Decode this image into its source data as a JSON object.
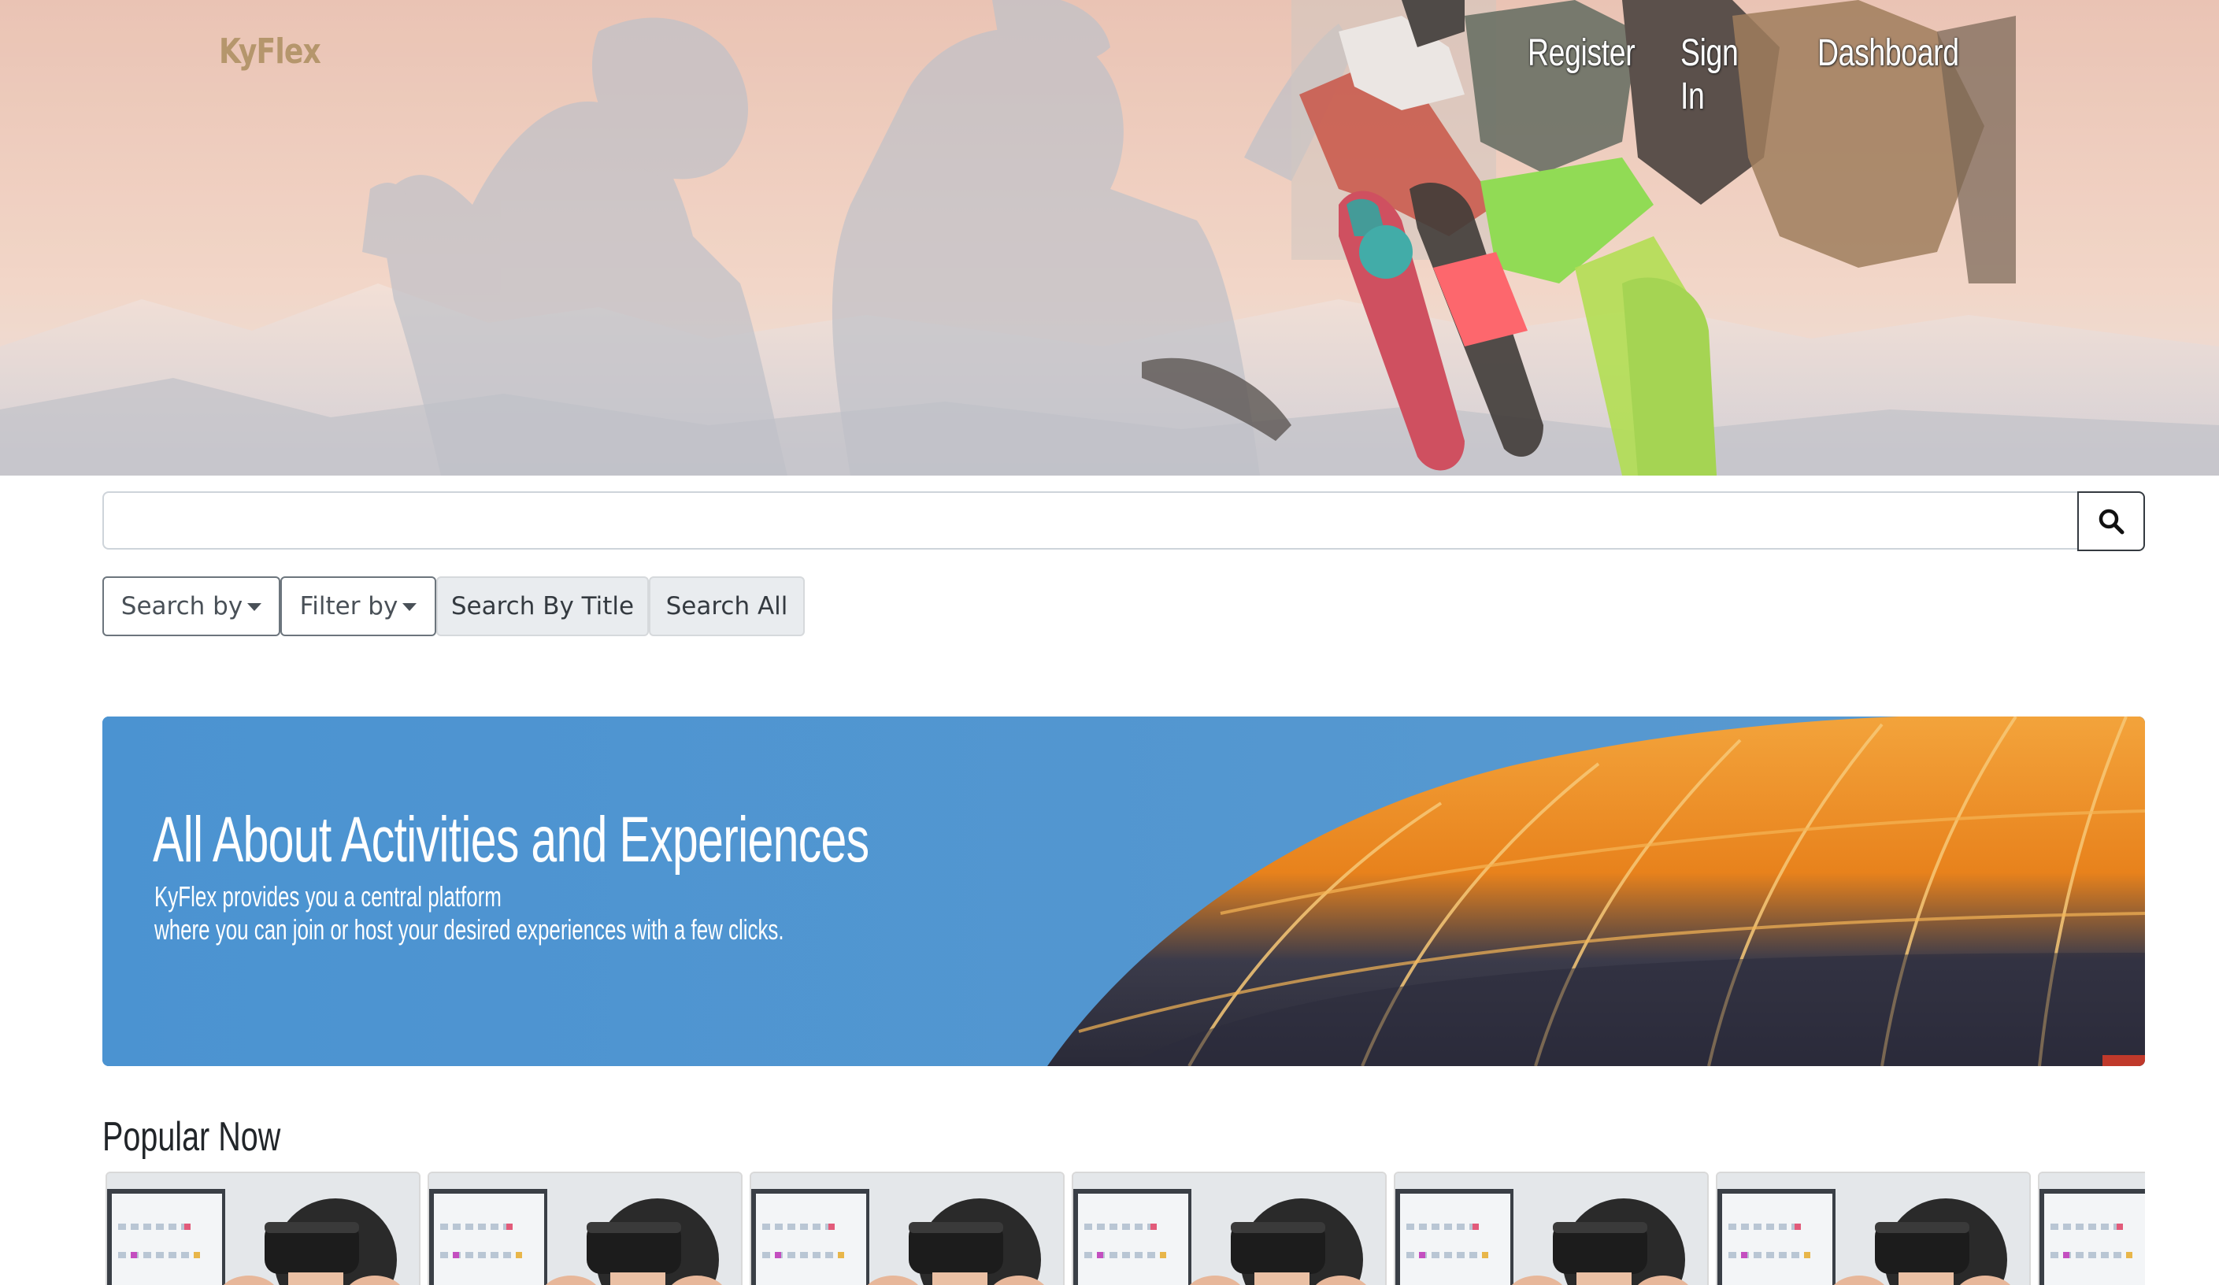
{
  "brand": "KyFlex",
  "nav": {
    "register": "Register",
    "sign_in": "Sign In",
    "dashboard": "Dashboard"
  },
  "search": {
    "value": "",
    "placeholder": "",
    "button_icon": "search-icon"
  },
  "filters": {
    "search_by": "Search by",
    "filter_by": "Filter by",
    "search_by_title": "Search By Title",
    "search_all": "Search All"
  },
  "banner": {
    "title": "All About Activities and Experiences",
    "line1": "KyFlex provides you a central platform",
    "line2": "where you can join or host your desired experiences with a few clicks."
  },
  "popular": {
    "title": "Popular Now",
    "cards": [
      {
        "image": "vr-headset-photo"
      },
      {
        "image": "vr-headset-photo"
      },
      {
        "image": "vr-headset-photo"
      },
      {
        "image": "vr-headset-photo"
      },
      {
        "image": "vr-headset-photo"
      },
      {
        "image": "vr-headset-photo"
      },
      {
        "image": "vr-headset-photo"
      }
    ]
  },
  "colors": {
    "brand": "#b5966c",
    "banner_blue": "#4a92cf",
    "balloon_orange": "#f0932b"
  }
}
